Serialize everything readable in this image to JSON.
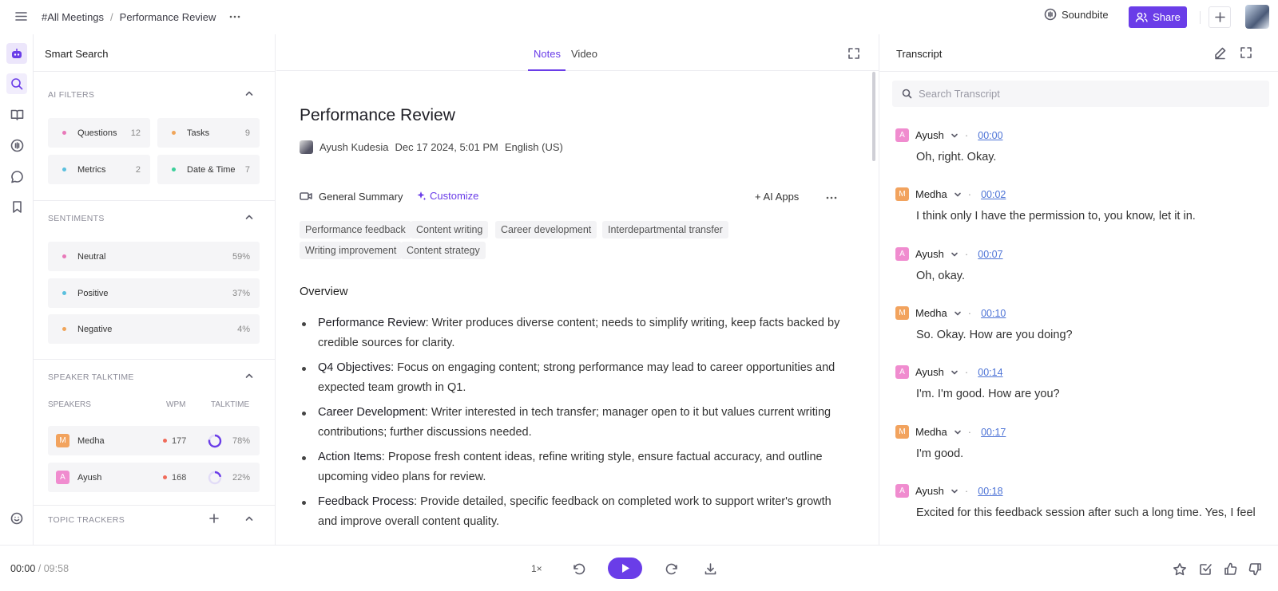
{
  "topbar": {
    "breadcrumb": [
      "#All Meetings",
      "/",
      "Performance Review"
    ],
    "soundbite_label": "Soundbite",
    "share_label": "Share"
  },
  "left": {
    "title": "Smart Search",
    "ai_filters": {
      "heading": "AI FILTERS",
      "items": [
        {
          "label": "Questions",
          "count": "12",
          "color": "#e879b9"
        },
        {
          "label": "Tasks",
          "count": "9",
          "color": "#f0a55a"
        },
        {
          "label": "Metrics",
          "count": "2",
          "color": "#5bc0de"
        },
        {
          "label": "Date & Time",
          "count": "7",
          "color": "#3ccf9a"
        }
      ]
    },
    "sentiments": {
      "heading": "SENTIMENTS",
      "items": [
        {
          "label": "Neutral",
          "value": "59%",
          "color": "#e879b9"
        },
        {
          "label": "Positive",
          "value": "37%",
          "color": "#5bc0de"
        },
        {
          "label": "Negative",
          "value": "4%",
          "color": "#f0a55a"
        }
      ]
    },
    "talktime": {
      "heading": "SPEAKER TALKTIME",
      "col_speakers": "SPEAKERS",
      "col_wpm": "WPM",
      "col_talktime": "TALKTIME",
      "speakers": [
        {
          "initial": "M",
          "name": "Medha",
          "wpm": "177",
          "pct": "78%",
          "fraction": 0.78,
          "color": "#f2a35e"
        },
        {
          "initial": "A",
          "name": "Ayush",
          "wpm": "168",
          "pct": "22%",
          "fraction": 0.22,
          "color": "#f08ccf"
        }
      ]
    },
    "topic_trackers": {
      "heading": "TOPIC TRACKERS"
    }
  },
  "center": {
    "tabs": [
      "Notes",
      "Video"
    ],
    "title": "Performance Review",
    "author": "Ayush Kudesia",
    "date": "Dec 17 2024, 5:01 PM",
    "language": "English (US)",
    "summary_label": "General Summary",
    "customize_label": "Customize",
    "ai_apps_label": "+ AI Apps",
    "tags": [
      "Performance feedback",
      "Content writing",
      "Career development",
      "Interdepartmental transfer",
      "Writing improvement",
      "Content strategy"
    ],
    "overview_heading": "Overview",
    "bullets": [
      {
        "head": "Performance Review",
        "body": ": Writer produces diverse content; needs to simplify writing, keep facts backed by credible sources for clarity."
      },
      {
        "head": "Q4 Objectives",
        "body": ": Focus on engaging content; strong performance may lead to career opportunities and expected team growth in Q1."
      },
      {
        "head": "Career Development",
        "body": ": Writer interested in tech transfer; manager open to it but values current writing contributions; further discussions needed."
      },
      {
        "head": "Action Items",
        "body": ": Propose fresh content ideas, refine writing style, ensure factual accuracy, and outline upcoming video plans for review."
      },
      {
        "head": "Feedback Process",
        "body": ": Provide detailed, specific feedback on completed work to support writer's growth and improve overall content quality."
      }
    ]
  },
  "transcript": {
    "title": "Transcript",
    "search_placeholder": "Search Transcript",
    "entries": [
      {
        "initial": "A",
        "speaker": "Ayush",
        "time": "00:00",
        "text": "Oh, right. Okay.",
        "color": "#f08ccf"
      },
      {
        "initial": "M",
        "speaker": "Medha",
        "time": "00:02",
        "text": "I think only I have the permission to, you know, let it in.",
        "color": "#f2a35e"
      },
      {
        "initial": "A",
        "speaker": "Ayush",
        "time": "00:07",
        "text": "Oh, okay.",
        "color": "#f08ccf"
      },
      {
        "initial": "M",
        "speaker": "Medha",
        "time": "00:10",
        "text": "So. Okay. How are you doing?",
        "color": "#f2a35e"
      },
      {
        "initial": "A",
        "speaker": "Ayush",
        "time": "00:14",
        "text": "I'm. I'm good. How are you?",
        "color": "#f08ccf"
      },
      {
        "initial": "M",
        "speaker": "Medha",
        "time": "00:17",
        "text": "I'm good.",
        "color": "#f2a35e"
      },
      {
        "initial": "A",
        "speaker": "Ayush",
        "time": "00:18",
        "text": "Excited for this feedback session after such a long time. Yes, I feel",
        "color": "#f08ccf"
      }
    ]
  },
  "player": {
    "current": "00:00",
    "separator": "/",
    "total": "09:58",
    "speed": "1×"
  },
  "colors": {
    "accent": "#6a3de8"
  }
}
